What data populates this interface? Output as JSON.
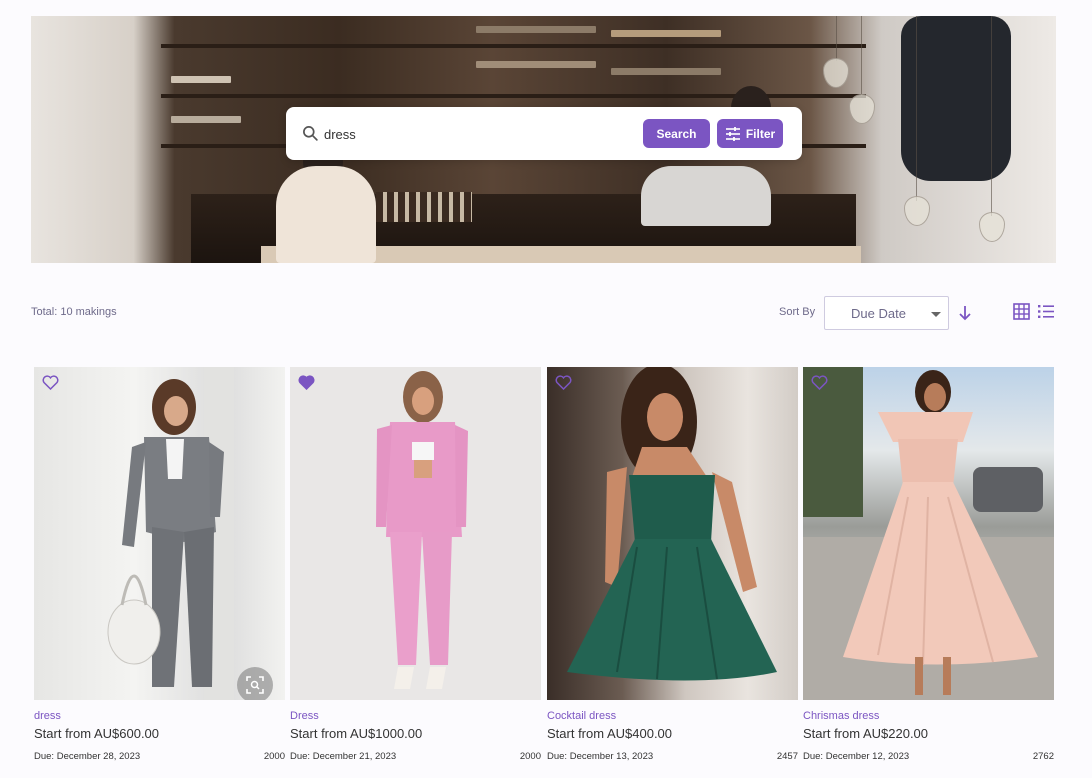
{
  "search": {
    "value": "dress",
    "search_label": "Search",
    "filter_label": "Filter"
  },
  "toolbar": {
    "total": "Total: 10 makings",
    "sort_by_label": "Sort By",
    "sort_value": "Due Date"
  },
  "colors": {
    "accent": "#7b55c2",
    "muted_text": "#6e6a8a"
  },
  "cards": [
    {
      "tag": "dress",
      "price": "Start from AU$600.00",
      "due": "Due: December 28, 2023",
      "count": "2000",
      "favorited": false
    },
    {
      "tag": "Dress",
      "price": "Start from AU$1000.00",
      "due": "Due: December 21, 2023",
      "count": "2000",
      "favorited": true
    },
    {
      "tag": "Cocktail dress",
      "price": "Start from AU$400.00",
      "due": "Due: December 13, 2023",
      "count": "2457",
      "favorited": false
    },
    {
      "tag": "Chrismas dress",
      "price": "Start from AU$220.00",
      "due": "Due: December 12, 2023",
      "count": "2762",
      "favorited": false
    }
  ]
}
